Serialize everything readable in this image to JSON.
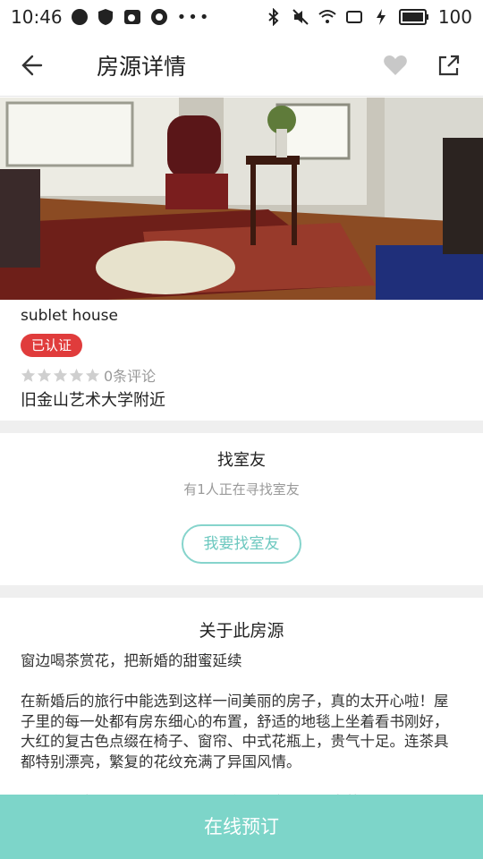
{
  "status_bar": {
    "time": "10:46",
    "battery": "100"
  },
  "app_bar": {
    "title": "房源详情",
    "back_icon": "arrow-left-icon",
    "favorite_icon": "heart-icon",
    "share_icon": "share-icon"
  },
  "listing": {
    "name": "sublet house",
    "badge": "已认证",
    "badge_color": "#e03c3c",
    "rating": 0,
    "review_count": "0条评论",
    "location": "旧金山艺术大学附近"
  },
  "roommate": {
    "title": "找室友",
    "subtitle": "有1人正在寻找室友",
    "button": "我要找室友"
  },
  "about": {
    "title": "关于此房源",
    "text": "窗边喝茶赏花，把新婚的甜蜜延续\n\n在新婚后的旅行中能选到这样一间美丽的房子，真的太开心啦！屋子里的每一处都有房东细心的布置，舒适的地毯上坐着看书刚好，大红的复古色点缀在椅子、窗帘、中式花瓶上，贵气十足。连茶具都特别漂亮，繁复的花纹充满了异国风情。\n\n清晨在卧室里醒来，微风吹动纱窗，到客厅泡一壶茶，看看世"
  },
  "footer": {
    "book_button": "在线预订",
    "accent_color": "#7dd5c9"
  }
}
